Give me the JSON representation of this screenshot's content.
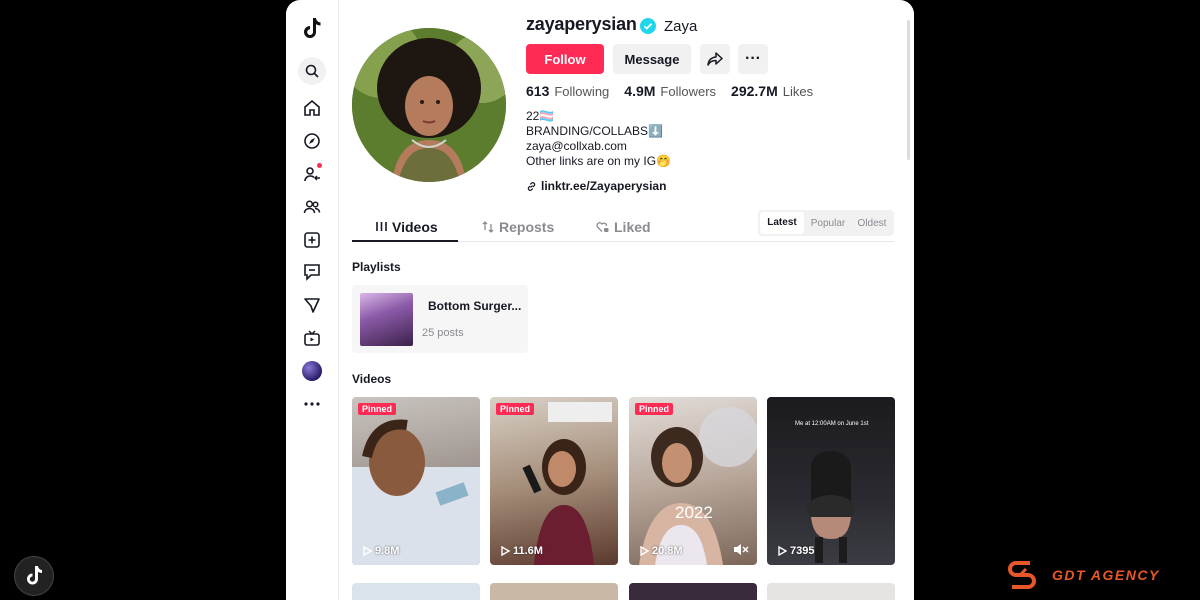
{
  "profile": {
    "username": "zayaperysian",
    "nickname": "Zaya",
    "follow_label": "Follow",
    "message_label": "Message",
    "more_label": "···",
    "stats": {
      "following_count": "613",
      "following_label": "Following",
      "followers_count": "4.9M",
      "followers_label": "Followers",
      "likes_count": "292.7M",
      "likes_label": "Likes"
    },
    "bio": {
      "line1": "22🏳️‍⚧️",
      "line2": "BRANDING/COLLABS⬇️",
      "line3": "zaya@collxab.com",
      "line4": "Other links are on my IG🤭"
    },
    "link": "linktr.ee/Zayaperysian"
  },
  "tabs": {
    "videos": "Videos",
    "reposts": "Reposts",
    "liked": "Liked"
  },
  "sort": {
    "latest": "Latest",
    "popular": "Popular",
    "oldest": "Oldest"
  },
  "playlists": {
    "heading": "Playlists",
    "items": [
      {
        "title": "Bottom Surger...",
        "count": "25 posts"
      }
    ]
  },
  "videos": {
    "heading": "Videos",
    "pinned_label": "Pinned",
    "items": [
      {
        "views": "9.8M",
        "pinned": true
      },
      {
        "views": "11.6M",
        "pinned": true
      },
      {
        "views": "20.8M",
        "pinned": true,
        "overlay": "2022",
        "muted": true
      },
      {
        "views": "7395",
        "pinned": false,
        "caption": "Me at 12:00AM on June 1st"
      }
    ]
  },
  "watermark": {
    "brand": "GDT AGENCY"
  },
  "colors": {
    "accent": "#fe2c55",
    "verified": "#20d5ec",
    "brand": "#e8572a"
  }
}
